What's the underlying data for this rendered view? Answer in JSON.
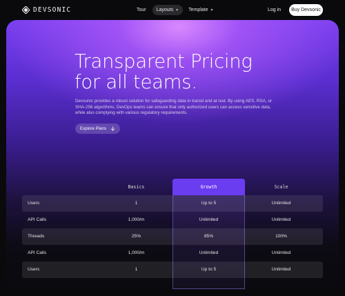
{
  "brand": {
    "name": "DEVSONIC"
  },
  "nav": {
    "items": [
      {
        "label": "Tour",
        "has_dropdown": false,
        "active": false
      },
      {
        "label": "Layouts",
        "has_dropdown": true,
        "active": true
      },
      {
        "label": "Template",
        "has_dropdown": true,
        "active": false
      }
    ],
    "login_label": "Log in",
    "buy_label": "Buy Devsonic"
  },
  "hero": {
    "title": "Transparent Pricing\nfor all teams.",
    "description": "Devsonic provides a robust solution for safeguarding data in transit and at rest. By using AES, RSA, or SHA-256 algorithms, DevOps teams can ensure that only authorized users can access sensitive data, while also complying with various regulatory requirements.",
    "cta_label": "Explore Plans"
  },
  "pricing": {
    "columns": [
      "Basics",
      "Growth",
      "Scale"
    ],
    "highlighted_column": "Growth",
    "rows": [
      {
        "feature": "Users",
        "basics": "1",
        "growth": "Up to 5",
        "scale": "Unlimited"
      },
      {
        "feature": "API Calls",
        "basics": "1,000/m",
        "growth": "Unlimited",
        "scale": "Unlimited"
      },
      {
        "feature": "Threads",
        "basics": "25%",
        "growth": "85%",
        "scale": "100%"
      },
      {
        "feature": "API Calls",
        "basics": "1,000/m",
        "growth": "Unlimited",
        "scale": "Unlimited"
      },
      {
        "feature": "Users",
        "basics": "1",
        "growth": "Up to 5",
        "scale": "Unlimited"
      }
    ]
  },
  "colors": {
    "accent": "#6b3df0",
    "hero_glow": "#d98cff",
    "background": "#0a0a0c"
  }
}
